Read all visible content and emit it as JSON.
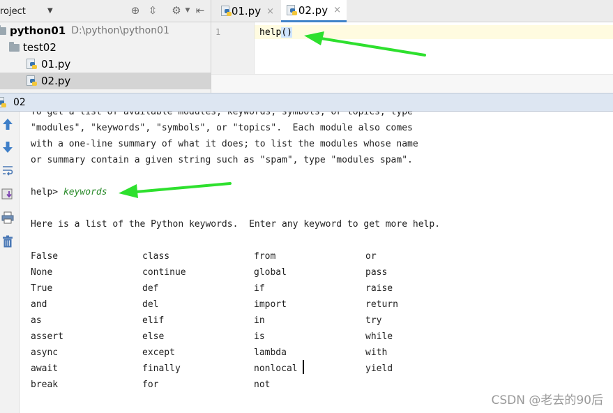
{
  "project_panel": {
    "title": "roject",
    "dropdown_icon": "triangle-down-icon",
    "header_icons": [
      "crosshair-icon",
      "collapse-all-icon",
      "gear-icon",
      "hide-panel-icon"
    ],
    "tree": [
      {
        "label": "python01",
        "path": "D:\\python\\python01",
        "icon": "folder-icon",
        "selected": false
      },
      {
        "label": "test02",
        "icon": "folder-icon",
        "selected": false
      },
      {
        "label": "01.py",
        "icon": "python-file-icon",
        "selected": false
      },
      {
        "label": "02.py",
        "icon": "python-file-icon",
        "selected": true
      }
    ]
  },
  "editor": {
    "tabs": [
      {
        "label": "01.py",
        "active": false,
        "close": "×"
      },
      {
        "label": "02.py",
        "active": true,
        "close": "×"
      }
    ],
    "line_number": "1",
    "code_name": "help",
    "code_parens": "()"
  },
  "run_panel": {
    "tab_label": "02",
    "toolbar_icons": [
      "arrow-up-icon",
      "arrow-down-icon",
      "soft-wrap-icon",
      "scroll-to-end-icon",
      "print-icon",
      "trash-icon"
    ],
    "intro_lines": [
      "To get a list of available modules, keywords, symbols, or topics, type",
      "\"modules\", \"keywords\", \"symbols\", or \"topics\".  Each module also comes",
      "with a one-line summary of what it does; to list the modules whose name",
      "or summary contain a given string such as \"spam\", type \"modules spam\"."
    ],
    "prompt": "help> ",
    "typed_input": "keywords",
    "keywords_intro": "Here is a list of the Python keywords.  Enter any keyword to get more help.",
    "keyword_columns": [
      [
        "False",
        "None",
        "True",
        "and",
        "as",
        "assert",
        "async",
        "await",
        "break"
      ],
      [
        "class",
        "continue",
        "def",
        "del",
        "elif",
        "else",
        "except",
        "finally",
        "for"
      ],
      [
        "from",
        "global",
        "if",
        "import",
        "in",
        "is",
        "lambda",
        "nonlocal",
        "not"
      ],
      [
        "or",
        "pass",
        "raise",
        "return",
        "try",
        "while",
        "with",
        "yield"
      ]
    ]
  },
  "watermark": "CSDN @老去的90后",
  "colors": {
    "accent": "#4083c9",
    "annotation_arrow": "#2ee02e",
    "typed_input": "#2a8a2a",
    "run_header": "#dde6f2"
  }
}
